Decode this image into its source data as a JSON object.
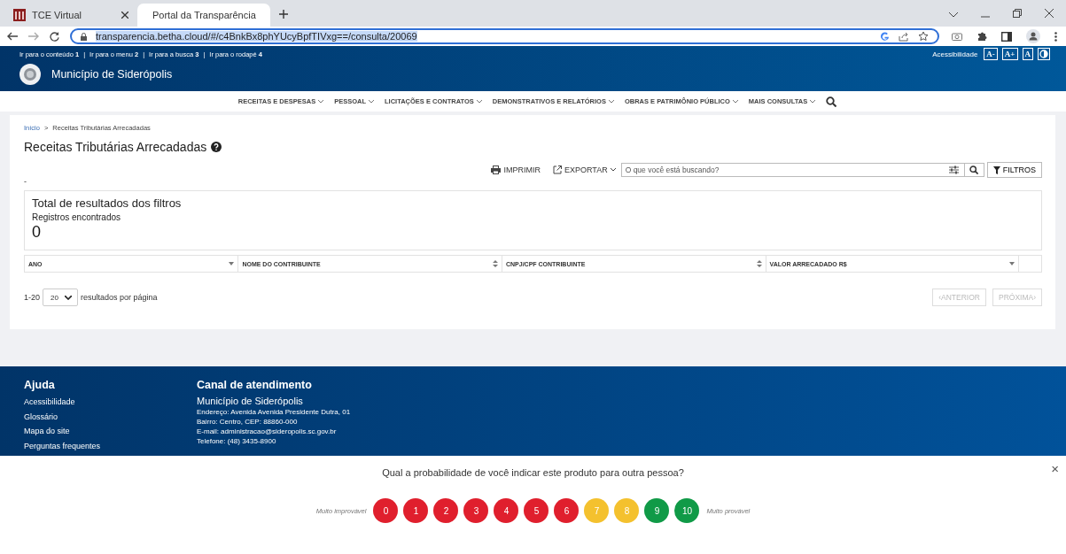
{
  "browser": {
    "tabs": [
      {
        "label": "TCE Virtual",
        "selected": false
      },
      {
        "label": "Portal da Transparência",
        "selected": true
      }
    ],
    "url": "transparencia.betha.cloud/#/c4BnkBx8phYUcyBpfTIVxg==/consulta/20069"
  },
  "skip_separator": "|",
  "skip_links": [
    "Ir para o conteúdo **1**",
    "Ir para o menu **2**",
    "Ir para a busca **3**",
    "Ir para o rodapé **4**"
  ],
  "accessibility": {
    "label": "Acessibilidade",
    "buttons": [
      "A-",
      "A+",
      "A"
    ]
  },
  "site_title": "Município de Siderópolis",
  "nav": [
    "RECEITAS E DESPESAS",
    "PESSOAL",
    "LICITAÇÕES E CONTRATOS",
    "DEMONSTRATIVOS E RELATÓRIOS",
    "OBRAS E PATRIMÔNIO PÚBLICO",
    "MAIS CONSULTAS"
  ],
  "breadcrumb": [
    "Início",
    "Receitas Tributárias Arrecadadas"
  ],
  "breadcrumb_separator": ">",
  "page_title": "Receitas Tributárias Arrecadadas",
  "toolbar": {
    "print": "IMPRIMIR",
    "export": "EXPORTAR",
    "search": {
      "placeholder": "O que você está buscando?"
    },
    "filters": "FILTROS"
  },
  "dash": "-",
  "summary": {
    "title": "Total de resultados dos filtros",
    "label": "Registros encontrados",
    "count": "0"
  },
  "table": {
    "columns": [
      {
        "label": "ANO"
      },
      {
        "label": "NOME DO CONTRIBUINTE"
      },
      {
        "label": "CNPJ/CPF CONTRIBUINTE"
      },
      {
        "label": "VALOR ARRECADADO R$"
      }
    ]
  },
  "pagination": {
    "range": "1-20",
    "page_size": "20",
    "per_page_label": "resultados por página",
    "previous": "‹ANTERIOR",
    "next": "PRÓXIMA›",
    "previous_disabled": true,
    "next_disabled": true
  },
  "footer": {
    "help_title": "Ajuda",
    "help_links": [
      "Acessibilidade",
      "Glossário",
      "Mapa do site",
      "Perguntas frequentes"
    ],
    "contact_title": "Canal de atendimento",
    "contact_name": "Município de Siderópolis",
    "contact_lines": [
      "Endereço: Avenida Avenida Presidente Dutra, 01",
      "Bairro: Centro, CEP: 88860-000",
      "E-mail: administracao@sideropolis.sc.gov.br",
      "Telefone: (48) 3435-8900"
    ]
  },
  "survey": {
    "question": "Qual a probabilidade de você indicar este produto para outra pessoa?",
    "low_label": "Muito improvável",
    "high_label": "Muito provável",
    "close": "×",
    "scores": [
      {
        "label": "0",
        "color": "#e01f2d"
      },
      {
        "label": "1",
        "color": "#e01f2d"
      },
      {
        "label": "2",
        "color": "#e01f2d"
      },
      {
        "label": "3",
        "color": "#e01f2d"
      },
      {
        "label": "4",
        "color": "#e01f2d"
      },
      {
        "label": "5",
        "color": "#e01f2d"
      },
      {
        "label": "6",
        "color": "#e01f2d"
      },
      {
        "label": "7",
        "color": "#f4c12e"
      },
      {
        "label": "8",
        "color": "#f4c12e"
      },
      {
        "label": "9",
        "color": "#109a47"
      },
      {
        "label": "10",
        "color": "#109a47"
      }
    ]
  }
}
